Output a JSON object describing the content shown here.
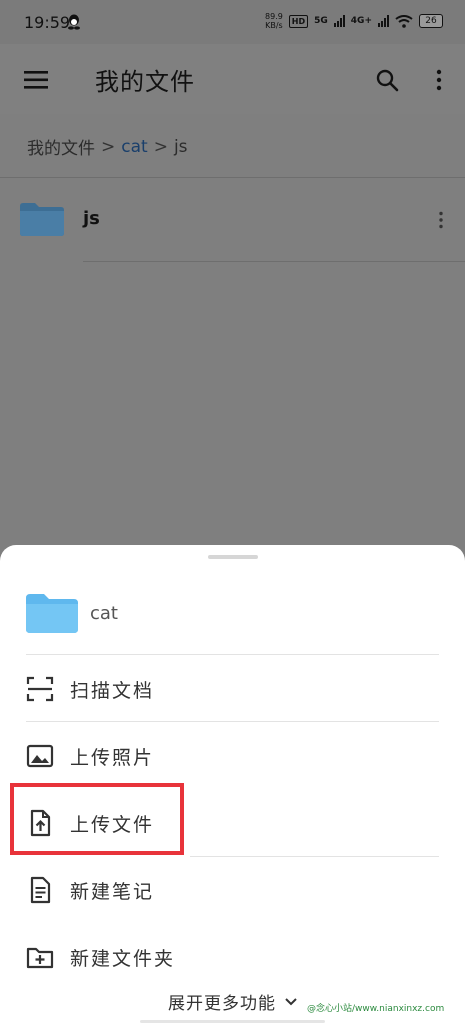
{
  "status": {
    "time": "19:59",
    "net_speed_value": "89.9",
    "net_speed_unit": "KB/s",
    "hd_label": "HD",
    "sig1_label": "5G",
    "sig2_label": "4G+",
    "battery": "26"
  },
  "appbar": {
    "title": "我的文件"
  },
  "breadcrumb": {
    "root": "我的文件",
    "sep": ">",
    "folder": "cat",
    "current": "js"
  },
  "files": [
    {
      "name": "js"
    }
  ],
  "sheet": {
    "folder_name": "cat",
    "actions": [
      {
        "label": "扫描文档",
        "icon": "scan-icon"
      },
      {
        "label": "上传照片",
        "icon": "image-icon"
      },
      {
        "label": "上传文件",
        "icon": "upload-file-icon"
      },
      {
        "label": "新建笔记",
        "icon": "note-icon"
      },
      {
        "label": "新建文件夹",
        "icon": "new-folder-icon"
      }
    ],
    "expand_label": "展开更多功能"
  },
  "watermark": "@念心小站/www.nianxinxz.com",
  "colors": {
    "folder_blue": "#74c6f4",
    "highlight_red": "#e8333a",
    "link_blue": "#1a3f6b"
  }
}
